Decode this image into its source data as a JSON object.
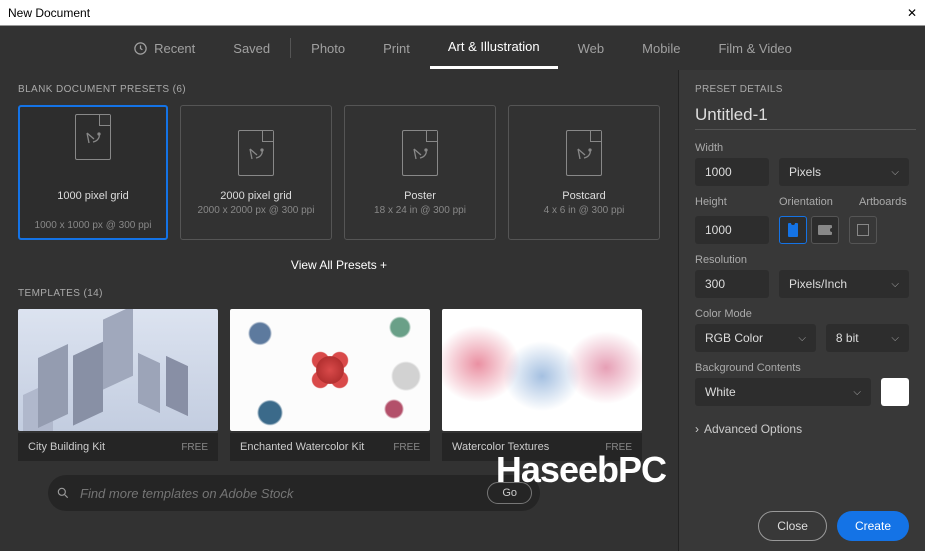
{
  "window": {
    "title": "New Document"
  },
  "tabs": {
    "recent": "Recent",
    "saved": "Saved",
    "photo": "Photo",
    "print": "Print",
    "art": "Art & Illustration",
    "web": "Web",
    "mobile": "Mobile",
    "film": "Film & Video"
  },
  "presets": {
    "section_title": "BLANK DOCUMENT PRESETS (6)",
    "items": [
      {
        "name": "1000 pixel grid",
        "sub": "1000 x 1000 px @ 300 ppi"
      },
      {
        "name": "2000 pixel grid",
        "sub": "2000 x 2000 px @ 300 ppi"
      },
      {
        "name": "Poster",
        "sub": "18 x 24 in @ 300 ppi"
      },
      {
        "name": "Postcard",
        "sub": "4 x 6 in @ 300 ppi"
      }
    ],
    "view_all": "View All Presets +"
  },
  "templates": {
    "section_title": "TEMPLATES (14)",
    "items": [
      {
        "name": "City Building Kit",
        "price": "FREE"
      },
      {
        "name": "Enchanted Watercolor Kit",
        "price": "FREE"
      },
      {
        "name": "Watercolor Textures",
        "price": "FREE"
      }
    ]
  },
  "search": {
    "placeholder": "Find more templates on Adobe Stock",
    "go": "Go"
  },
  "details": {
    "heading": "PRESET DETAILS",
    "doc_name": "Untitled-1",
    "width_label": "Width",
    "width_value": "1000",
    "width_unit": "Pixels",
    "height_label": "Height",
    "height_value": "1000",
    "orientation_label": "Orientation",
    "artboards_label": "Artboards",
    "resolution_label": "Resolution",
    "resolution_value": "300",
    "resolution_unit": "Pixels/Inch",
    "colormode_label": "Color Mode",
    "colormode_value": "RGB Color",
    "colordepth_value": "8 bit",
    "bg_label": "Background Contents",
    "bg_value": "White",
    "advanced": "Advanced Options"
  },
  "footer": {
    "close": "Close",
    "create": "Create"
  },
  "watermark": "HaseebPC"
}
